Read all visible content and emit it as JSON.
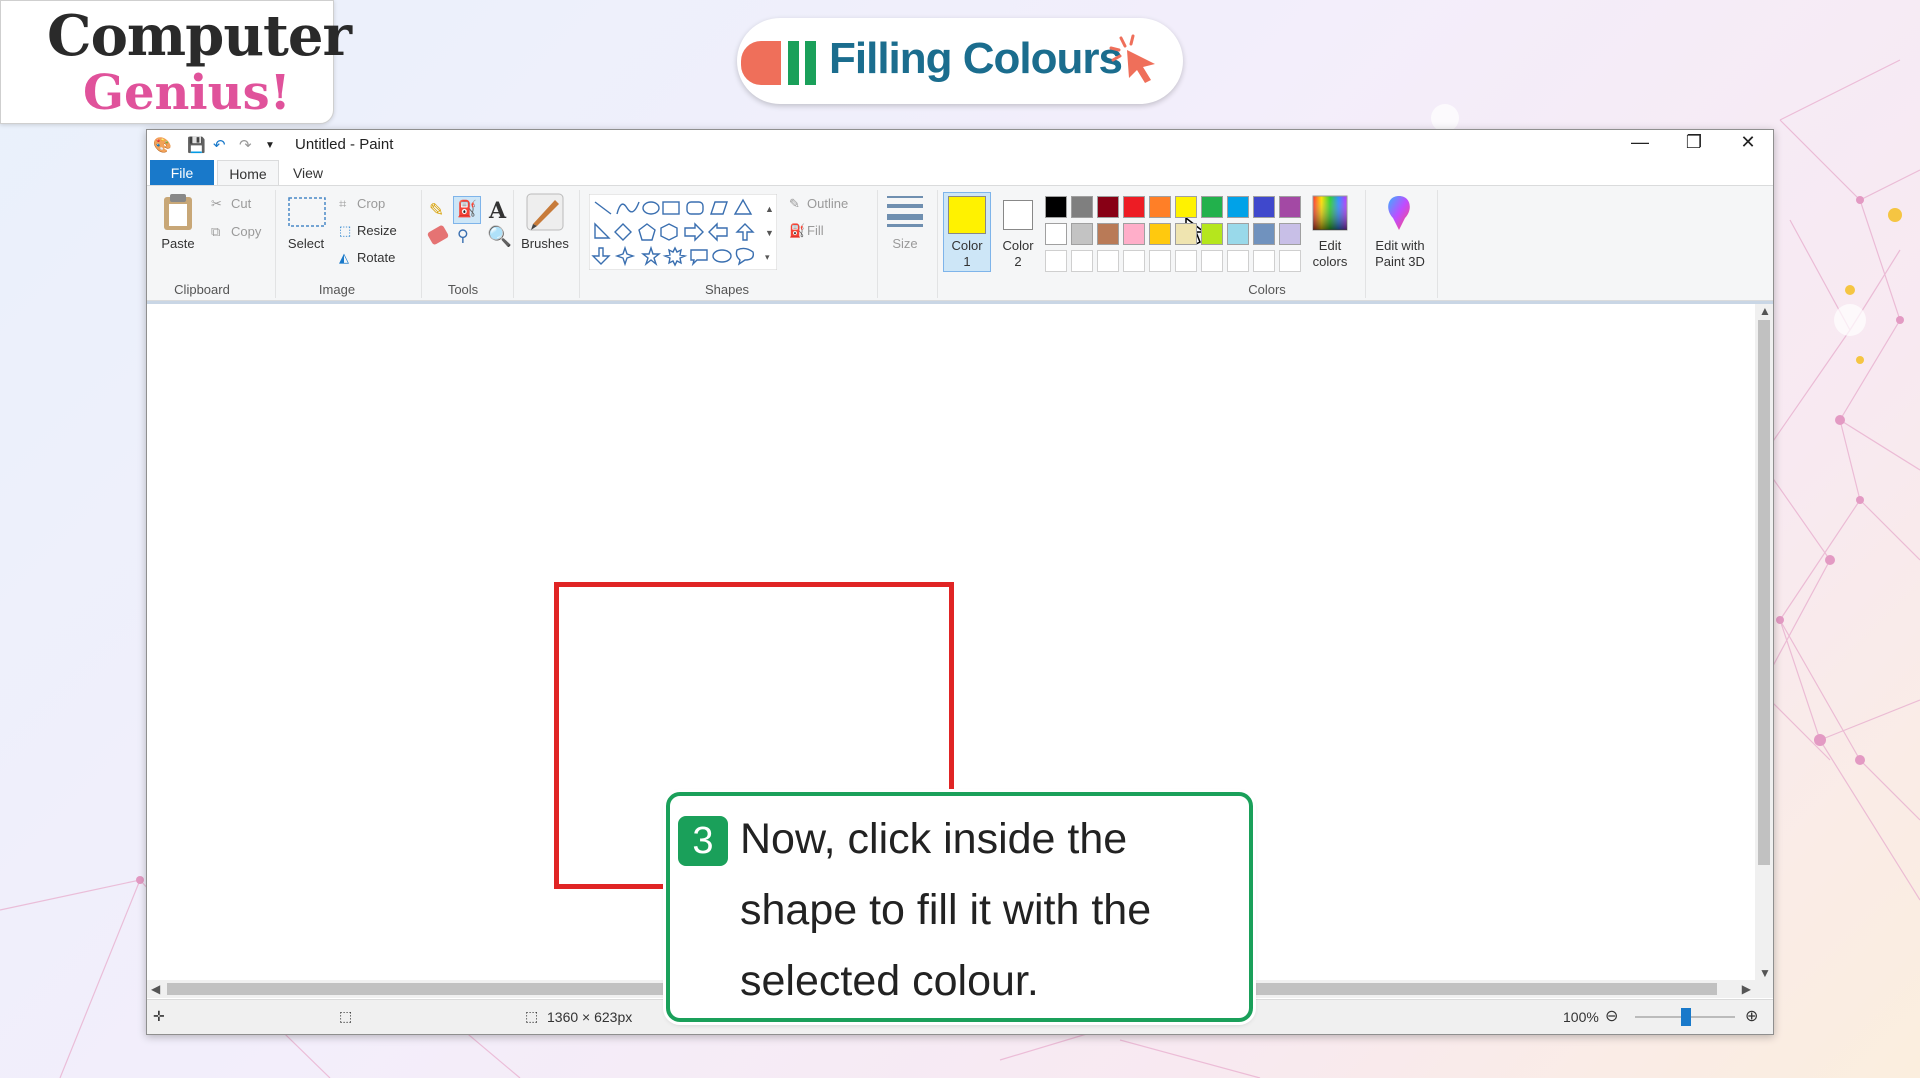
{
  "logo": {
    "line1": "Computer",
    "line2": "Genius!"
  },
  "lesson_title": "Filling Colours",
  "window": {
    "title": "Untitled - Paint",
    "minimize": "—",
    "restore": "❐",
    "close": "✕"
  },
  "tabs": {
    "file": "File",
    "home": "Home",
    "view": "View",
    "help": "?"
  },
  "ribbon": {
    "clipboard": {
      "paste": "Paste",
      "cut": "Cut",
      "copy": "Copy",
      "label": "Clipboard"
    },
    "image": {
      "select": "Select",
      "crop": "Crop",
      "resize": "Resize",
      "rotate": "Rotate",
      "label": "Image"
    },
    "tools": {
      "label": "Tools",
      "text_tool": "A"
    },
    "brushes": {
      "label": "Brushes"
    },
    "shapes": {
      "outline": "Outline",
      "fill": "Fill",
      "label": "Shapes"
    },
    "size": {
      "label": "Size"
    },
    "colors": {
      "color1_l1": "Color",
      "color1_l2": "1",
      "color2_l1": "Color",
      "color2_l2": "2",
      "edit_l1": "Edit",
      "edit_l2": "colors",
      "paint3d_l1": "Edit with",
      "paint3d_l2": "Paint 3D",
      "label": "Colors",
      "color1_value": "#fff200",
      "color2_value": "#ffffff",
      "palette_row1": [
        "#000000",
        "#7f7f7f",
        "#880015",
        "#ed1c24",
        "#ff7f27",
        "#fff200",
        "#22b14c",
        "#00a2e8",
        "#3f48cc",
        "#a349a4"
      ],
      "palette_row2": [
        "#ffffff",
        "#c3c3c3",
        "#b97a57",
        "#ffaec9",
        "#ffc90e",
        "#efe4b0",
        "#b5e61d",
        "#99d9ea",
        "#7092be",
        "#c8bfe7"
      ]
    }
  },
  "status": {
    "canvas_size": "1360 × 623px",
    "zoom": "100%"
  },
  "callout": {
    "step": "3",
    "text": "Now, click inside the shape to fill it with the selected colour."
  }
}
